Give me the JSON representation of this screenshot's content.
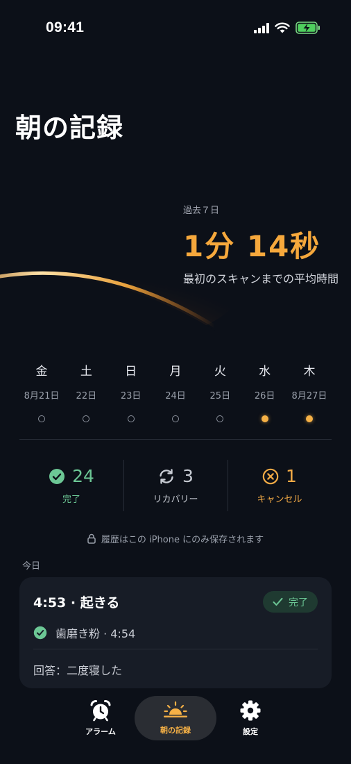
{
  "status_bar": {
    "time": "09:41"
  },
  "header": {
    "title": "朝の記録"
  },
  "summary": {
    "label": "過去７日",
    "value": "1分 14秒",
    "description": "最初のスキャンまでの平均時間"
  },
  "week": [
    {
      "name": "金",
      "date": "8月21日",
      "active": false
    },
    {
      "name": "土",
      "date": "22日",
      "active": false
    },
    {
      "name": "日",
      "date": "23日",
      "active": false
    },
    {
      "name": "月",
      "date": "24日",
      "active": false
    },
    {
      "name": "火",
      "date": "25日",
      "active": false
    },
    {
      "name": "水",
      "date": "26日",
      "active": true
    },
    {
      "name": "木",
      "date": "8月27日",
      "active": true
    }
  ],
  "stats": {
    "completed": {
      "value": "24",
      "label": "完了",
      "icon": "check-circle-icon",
      "color": "#6cc795"
    },
    "recovery": {
      "value": "3",
      "label": "リカバリー",
      "icon": "refresh-icon",
      "color": "#c8ccd4"
    },
    "cancelled": {
      "value": "1",
      "label": "キャンセル",
      "icon": "x-circle-icon",
      "color": "#f4ab46"
    }
  },
  "privacy": {
    "text": "履歴はこの iPhone にのみ保存されます",
    "icon": "lock-icon"
  },
  "today": {
    "section_label": "今日",
    "card": {
      "title": "4:53 · 起きる",
      "badge": "完了",
      "task": "歯磨き粉 · 4:54",
      "answer": "回答：二度寝した"
    }
  },
  "tabbar": {
    "alarm": "アラーム",
    "morning_log": "朝の記録",
    "settings": "設定"
  },
  "colors": {
    "accent": "#f6b146",
    "success": "#6cc795",
    "background": "#0c1018",
    "card": "#171c26"
  }
}
